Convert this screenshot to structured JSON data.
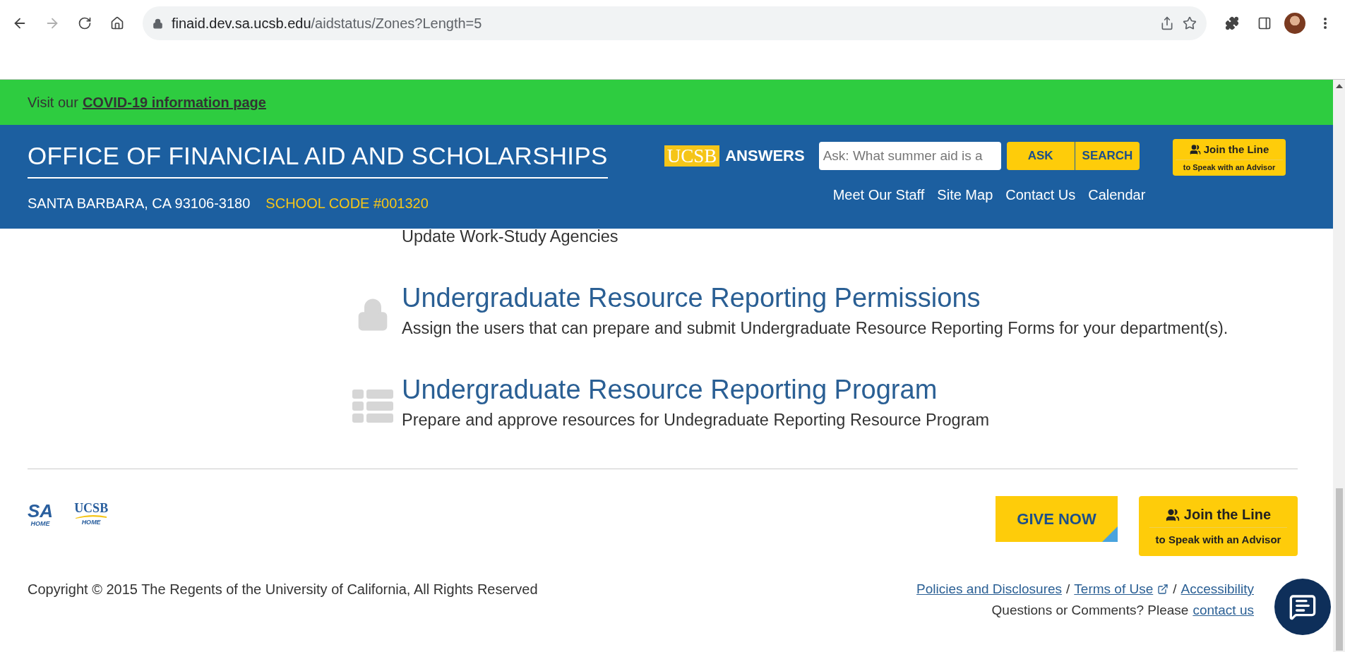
{
  "browser": {
    "url_host": "finaid.dev.sa.ucsb.edu",
    "url_path": "/aidstatus/Zones?Length=5",
    "forward_disabled": true
  },
  "banner": {
    "text": "Visit our",
    "link": "COVID-19 information page"
  },
  "header": {
    "title": "OFFICE OF FINANCIAL AID AND SCHOLARSHIPS",
    "address": "SANTA BARBARA, CA 93106-3180",
    "school_code": "SCHOOL CODE #001320",
    "answers_logo": "UCSB",
    "answers_label": "ANSWERS",
    "search_placeholder": "Ask: What summer aid is a",
    "buttons": [
      "ASK",
      "SEARCH"
    ],
    "nav": [
      "Meet Our Staff",
      "Site Map",
      "Contact Us",
      "Calendar"
    ],
    "join": {
      "title": "Join the Line",
      "subtitle": "to Speak with an Advisor"
    }
  },
  "items": [
    {
      "kind": "cut",
      "description": "Update Work-Study Agencies"
    },
    {
      "kind": "lock",
      "title": "Undergraduate Resource Reporting Permissions",
      "description": "Assign the users that can prepare and submit Undergraduate Resource Reporting Forms for your department(s)."
    },
    {
      "kind": "list",
      "title": "Undergraduate Resource Reporting Program",
      "description": "Prepare and approve resources for Undegraduate Reporting Resource Program"
    }
  ],
  "footer": {
    "logos": [
      {
        "kind": "sa",
        "mark": "SA",
        "caption": "HOME"
      },
      {
        "kind": "ucsb",
        "mark": "UCSB",
        "caption": "HOME"
      }
    ],
    "give": "GIVE NOW",
    "join": {
      "title": "Join the Line",
      "subtitle": "to Speak with an Advisor"
    },
    "copyright": "Copyright © 2015 The Regents of the University of California, All Rights Reserved",
    "links": [
      "Policies and Disclosures",
      "Terms of Use",
      "Accessibility"
    ],
    "separator": "/",
    "question": "Questions or Comments? Please",
    "contact": "contact us"
  }
}
